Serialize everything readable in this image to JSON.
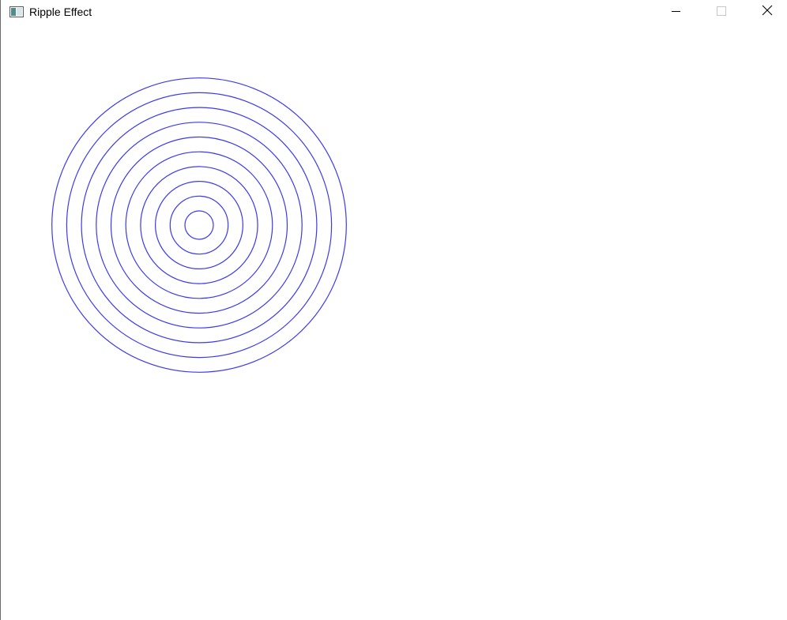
{
  "window": {
    "title": "Ripple Effect",
    "icon": "app-window-icon",
    "controls": {
      "minimize": "minimize-icon",
      "maximize": "maximize-icon",
      "close": "close-icon"
    }
  },
  "canvas": {
    "background": "#ffffff",
    "ripple": {
      "color": "#3a3af0",
      "ring_count": 10
    }
  }
}
